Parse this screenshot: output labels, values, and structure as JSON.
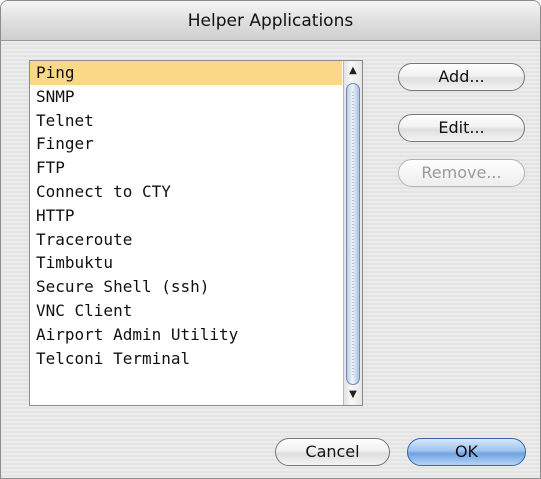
{
  "dialog": {
    "title": "Helper Applications"
  },
  "list": {
    "selected_index": 0,
    "items": [
      "Ping",
      "SNMP",
      "Telnet",
      "Finger",
      "FTP",
      "Connect to CTY",
      "HTTP",
      "Traceroute",
      "Timbuktu",
      "Secure Shell (ssh)",
      "VNC Client",
      "Airport Admin Utility",
      "Telconi Terminal"
    ],
    "selection_color": "#fbd888"
  },
  "scrollbar": {
    "up_arrow_icon": "up-arrow-icon",
    "down_arrow_icon": "down-arrow-icon",
    "up_glyph": "▲",
    "down_glyph": "▼"
  },
  "buttons": {
    "add_label": "Add...",
    "edit_label": "Edit...",
    "remove_label": "Remove...",
    "cancel_label": "Cancel",
    "ok_label": "OK",
    "remove_enabled": false
  },
  "colors": {
    "default_button": "#9ec4ef",
    "scroll_thumb": "#b9cde6"
  }
}
